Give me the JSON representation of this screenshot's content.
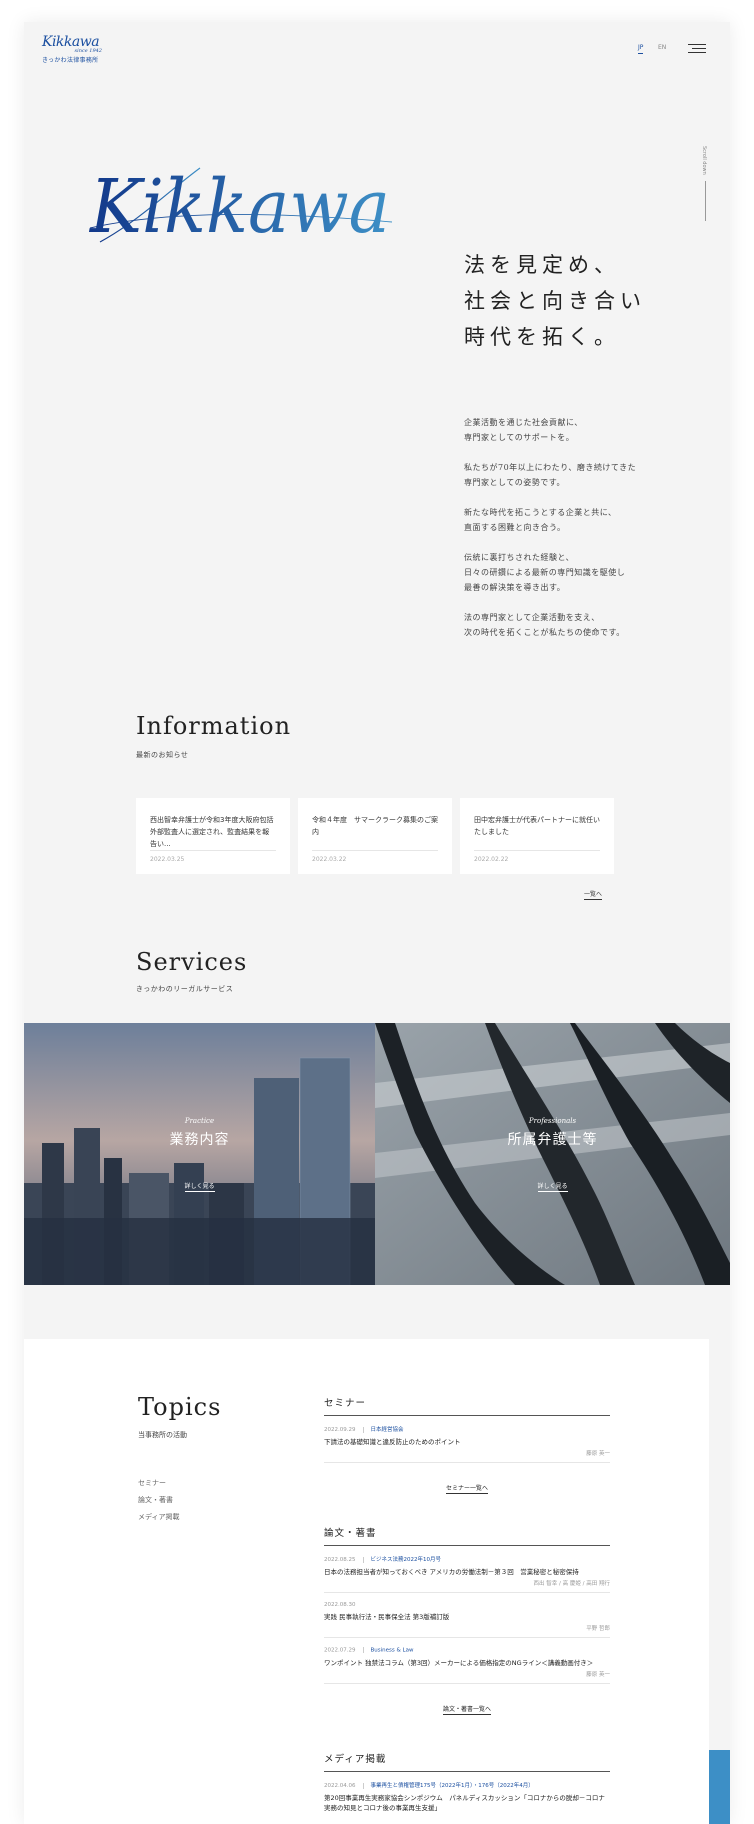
{
  "header": {
    "logo_script": "Kikkawa",
    "logo_since": "since 1942",
    "logo_jp": "きっかわ法律事務所",
    "lang_jp": "JP",
    "lang_en": "EN",
    "scroll_text": "Scroll down"
  },
  "hero": {
    "logo_text": "Kikkawa",
    "copy": [
      "法を見定め、",
      "社会と向き合い",
      "時代を拓く。"
    ],
    "body": [
      [
        "企業活動を通じた社会貢献に、",
        "専門家としてのサポートを。"
      ],
      [
        "私たちが70年以上にわたり、磨き続けてきた",
        "専門家としての姿勢です。"
      ],
      [
        "新たな時代を拓こうとする企業と共に、",
        "直面する困難と向き合う。"
      ],
      [
        "伝統に裏打ちされた経験と、",
        "日々の研鑽による最新の専門知識を駆使し",
        "最善の解決策を導き出す。"
      ],
      [
        "法の専門家として企業活動を支え、",
        "次の時代を拓くことが私たちの使命です。"
      ]
    ],
    "colors": {
      "brand_blue": "#1b4fa0",
      "gradient_light": "#3d8fc6"
    }
  },
  "information": {
    "title": "Information",
    "subtitle": "最新のお知らせ",
    "cards": [
      {
        "title": "西出智幸弁護士が令和3年度大阪府包括外部監査人に選定され、監査結果を報告い...",
        "date": "2022.03.25"
      },
      {
        "title": "令和４年度　サマークラーク募集のご案内",
        "date": "2022.03.22"
      },
      {
        "title": "田中宏弁護士が代表パートナーに就任いたしました",
        "date": "2022.02.22"
      }
    ],
    "more": "一覧へ"
  },
  "services": {
    "title": "Services",
    "subtitle": "きっかわのリーガルサービス",
    "items": [
      {
        "en": "Practice",
        "ja": "業務内容",
        "btn": "詳しく見る"
      },
      {
        "en": "Professionals",
        "ja": "所属弁護士等",
        "btn": "詳しく見る"
      }
    ]
  },
  "topics": {
    "title": "Topics",
    "subtitle": "当事務所の活動",
    "nav": [
      "セミナー",
      "論文・著書",
      "メディア掲載"
    ],
    "seminar": {
      "head": "セミナー",
      "items": [
        {
          "date": "2022.09.29",
          "cat": "日本経営協会",
          "title": "下請法の基礎知識と違反防止のためのポイント",
          "author": "藤原 英一"
        }
      ],
      "more": "セミナー一覧へ"
    },
    "papers": {
      "head": "論文・著書",
      "items": [
        {
          "date": "2022.08.25",
          "cat": "ビジネス法務2022年10月号",
          "title": "日本の法務担当者が知っておくべき アメリカの労働法制－第３回　営業秘密と秘密保持",
          "author": "西出 智幸 / 高 慶姫 / 高田 翔行"
        },
        {
          "date": "2022.08.30",
          "cat": "",
          "title": "実践 民事執行法・民事保全法 第3版補訂版",
          "author": "平野 哲郎"
        },
        {
          "date": "2022.07.29",
          "cat": "Business & Law",
          "title": "ワンポイント 独禁法コラム（第3回）メーカーによる価格指定のNGライン＜講義動画付き＞",
          "author": "藤原 英一"
        }
      ],
      "more": "論文・著書一覧へ"
    },
    "media": {
      "head": "メディア掲載",
      "items": [
        {
          "date": "2022.04.06",
          "cat": "事業再生と債権管理175号（2022年1月）・176号（2022年4月）",
          "title": "第20回事業再生実務家協会シンポジウム　パネルディスカッション「コロナからの脱却－コロナ実務の知見とコロナ後の事業再生支援」",
          "author": ""
        }
      ]
    }
  }
}
